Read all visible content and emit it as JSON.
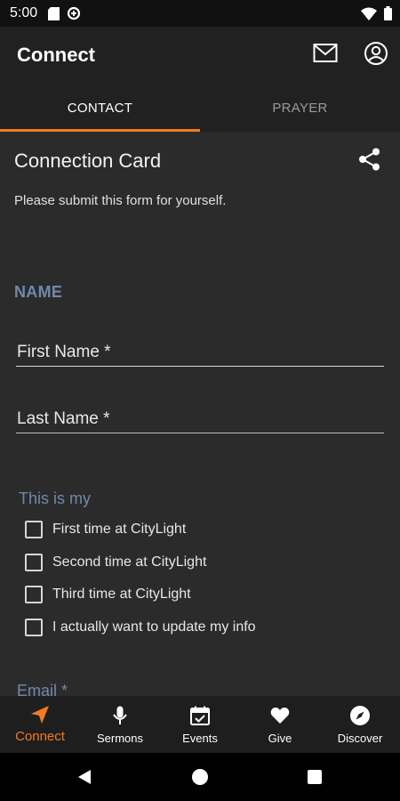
{
  "status_bar": {
    "time": "5:00",
    "left_icons": [
      "sd-card-icon",
      "data-saver-icon"
    ],
    "right_icons": [
      "wifi-icon",
      "battery-icon"
    ]
  },
  "app_bar": {
    "title": "Connect",
    "actions": [
      "mail-icon",
      "account-icon"
    ]
  },
  "tabs": [
    {
      "label": "CONTACT",
      "selected": true
    },
    {
      "label": "PRAYER",
      "selected": false
    }
  ],
  "form": {
    "title": "Connection Card",
    "share_icon": "share-icon",
    "subtitle": "Please submit this form for yourself.",
    "section_name": "NAME",
    "first_name_placeholder": "First Name *",
    "last_name_placeholder": "Last Name *",
    "group_label": "This is my",
    "options": [
      {
        "label": "First time at CityLight",
        "checked": false
      },
      {
        "label": "Second time at CityLight",
        "checked": false
      },
      {
        "label": "Third time at CityLight",
        "checked": false
      },
      {
        "label": "I actually want to update my info",
        "checked": false
      }
    ],
    "email_label": "Email *"
  },
  "bottom_nav": [
    {
      "label": "Connect",
      "icon": "send-icon",
      "active": true
    },
    {
      "label": "Sermons",
      "icon": "microphone-icon",
      "active": false
    },
    {
      "label": "Events",
      "icon": "calendar-icon",
      "active": false
    },
    {
      "label": "Give",
      "icon": "heart-icon",
      "active": false
    },
    {
      "label": "Discover",
      "icon": "compass-icon",
      "active": false
    }
  ],
  "colors": {
    "accent": "#f47b20",
    "section_label": "#7188ad",
    "background": "#2b2b2b",
    "bar": "#212121"
  }
}
